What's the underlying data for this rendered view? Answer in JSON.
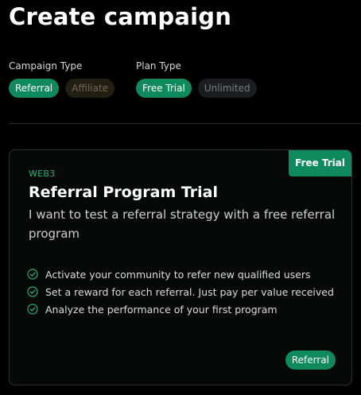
{
  "page": {
    "title": "Create campaign"
  },
  "campaign_type": {
    "label": "Campaign Type",
    "options": [
      {
        "label": "Referral",
        "selected": true
      },
      {
        "label": "Affiliate",
        "selected": false
      }
    ]
  },
  "plan_type": {
    "label": "Plan Type",
    "options": [
      {
        "label": "Free Trial",
        "selected": true
      },
      {
        "label": "Unlimited",
        "selected": false
      }
    ]
  },
  "card": {
    "ribbon": "Free Trial",
    "tag": "WEB3",
    "title": "Referral Program Trial",
    "description": "I want to test a referral strategy with a free referral program",
    "features": [
      "Activate your community to refer new qualified users",
      "Set a reward for each referral. Just pay per value received",
      "Analyze the performance of your first program"
    ],
    "badge": "Referral",
    "feature_icon": "check-circle-icon"
  },
  "colors": {
    "accent": "#0f8a5f",
    "accent_text": "#1fb27d",
    "background": "#000000",
    "card_border": "#2d3032"
  }
}
